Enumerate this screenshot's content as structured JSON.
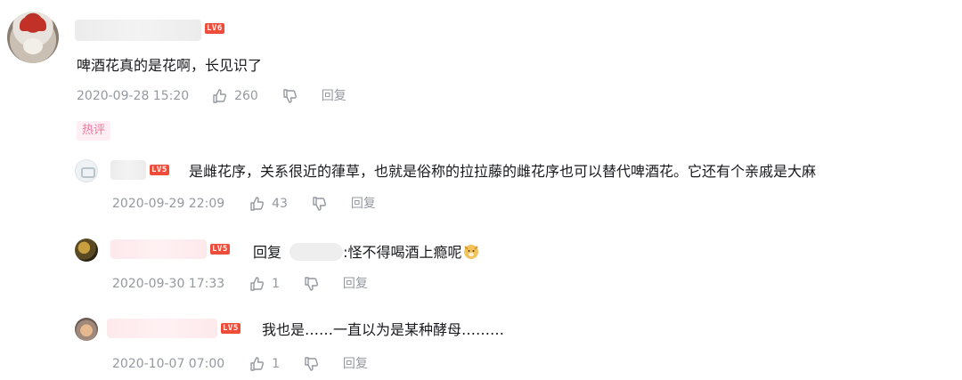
{
  "main_comment": {
    "level_badge": "LV6",
    "text": "啤酒花真的是花啊，长见识了",
    "date": "2020-09-28 15:20",
    "likes": "260",
    "reply_label": "回复",
    "hot_tag": "热评"
  },
  "replies": [
    {
      "level_badge": "LV5",
      "text": "是雌花序，关系很近的葎草，也就是俗称的拉拉藤的雌花序也可以替代啤酒花。它还有个亲戚是大麻",
      "date": "2020-09-29 22:09",
      "likes": "43",
      "reply_label": "回复"
    },
    {
      "level_badge": "LV5",
      "reply_prefix": "回复",
      "text": ":怪不得喝酒上瘾呢",
      "emoji": "doge-emoji",
      "date": "2020-09-30 17:33",
      "likes": "1",
      "reply_label": "回复"
    },
    {
      "level_badge": "LV5",
      "text": "我也是……一直以为是某种酵母………",
      "date": "2020-10-07 07:00",
      "likes": "1",
      "reply_label": "回复"
    }
  ],
  "colors": {
    "level_badge": "#f04c3a",
    "meta_gray": "#9499a0",
    "hot_tag_text": "#fb7299",
    "hot_tag_bg": "#ffeef3"
  }
}
